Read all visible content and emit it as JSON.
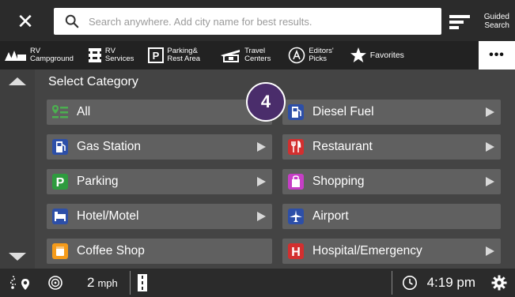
{
  "topbar": {
    "close_label": "✕",
    "search_placeholder": "Search anywhere. Add city name for best results.",
    "guided_label_line1": "Guided",
    "guided_label_line2": "Search"
  },
  "category_strip": {
    "items": [
      {
        "icon": "rv-campground-icon",
        "line1": "RV",
        "line2": "Campground"
      },
      {
        "icon": "rv-services-icon",
        "line1": "RV",
        "line2": "Services"
      },
      {
        "icon": "parking-rest-area-icon",
        "line1": "Parking&",
        "line2": "Rest Area"
      },
      {
        "icon": "travel-centers-icon",
        "line1": "Travel",
        "line2": "Centers"
      },
      {
        "icon": "editors-picks-icon",
        "line1": "Editors'",
        "line2": "Picks"
      },
      {
        "icon": "favorites-star-icon",
        "line1": "Favorites",
        "line2": ""
      }
    ],
    "more_label": "•••"
  },
  "main": {
    "section_title": "Select Category",
    "categories": [
      {
        "label": "All",
        "icon": "all-list-icon",
        "color": "#4caf50"
      },
      {
        "label": "Diesel Fuel",
        "icon": "diesel-fuel-icon",
        "color": "#2d4fa8"
      },
      {
        "label": "Gas Station",
        "icon": "gas-station-icon",
        "color": "#2d4fa8"
      },
      {
        "label": "Restaurant",
        "icon": "restaurant-icon",
        "color": "#d32f2f"
      },
      {
        "label": "Parking",
        "icon": "parking-icon",
        "color": "#2e9b3e"
      },
      {
        "label": "Shopping",
        "icon": "shopping-icon",
        "color": "#c63ec6"
      },
      {
        "label": "Hotel/Motel",
        "icon": "hotel-bed-icon",
        "color": "#2d4fa8"
      },
      {
        "label": "Airport",
        "icon": "airport-icon",
        "color": "#2d4fa8"
      },
      {
        "label": "Coffee Shop",
        "icon": "coffee-icon",
        "color": "#f59b1a"
      },
      {
        "label": "Hospital/Emergency",
        "icon": "hospital-icon",
        "color": "#d32f2f"
      }
    ],
    "step_badge": "4"
  },
  "statusbar": {
    "speed_value": "2",
    "speed_unit": "mph",
    "time": "4:19 pm"
  }
}
